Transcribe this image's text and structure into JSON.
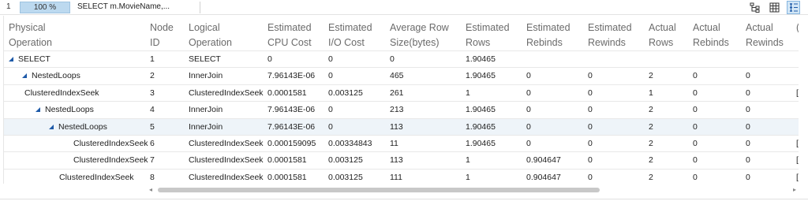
{
  "toolbar": {
    "row_number": "1",
    "zoom": "100 %",
    "query_text": "SELECT m.MovieName,...",
    "buttons": [
      {
        "icon": "tree-view-icon",
        "active": false
      },
      {
        "icon": "grid-view-icon",
        "active": false
      },
      {
        "icon": "list-view-icon",
        "active": true
      }
    ]
  },
  "columns": [
    "Physical\nOperation",
    "Node\nID",
    "Logical\nOperation",
    "Estimated\nCPU Cost",
    "Estimated\nI/O Cost",
    "Average Row\nSize(bytes)",
    "Estimated\nRows",
    "Estimated\nRebinds",
    "Estimated\nRewinds",
    "Actual\nRows",
    "Actual\nRebinds",
    "Actual\nRewinds",
    "("
  ],
  "rows": [
    {
      "level": 0,
      "expandable": true,
      "selected": false,
      "cells": [
        "SELECT",
        "1",
        "SELECT",
        "0",
        "0",
        "0",
        "1.90465",
        "",
        "",
        "",
        "",
        "",
        ""
      ]
    },
    {
      "level": 1,
      "expandable": true,
      "selected": false,
      "cells": [
        "NestedLoops",
        "2",
        "InnerJoin",
        "7.96143E-06",
        "0",
        "465",
        "1.90465",
        "0",
        "0",
        "2",
        "0",
        "0",
        ""
      ]
    },
    {
      "level": 2,
      "expandable": false,
      "selected": false,
      "cells": [
        "ClusteredIndexSeek",
        "3",
        "ClusteredIndexSeek",
        "0.0001581",
        "0.003125",
        "261",
        "1",
        "0",
        "0",
        "1",
        "0",
        "0",
        "["
      ]
    },
    {
      "level": 2,
      "expandable": true,
      "selected": false,
      "cells": [
        "NestedLoops",
        "4",
        "InnerJoin",
        "7.96143E-06",
        "0",
        "213",
        "1.90465",
        "0",
        "0",
        "2",
        "0",
        "0",
        ""
      ]
    },
    {
      "level": 3,
      "expandable": true,
      "selected": true,
      "cells": [
        "NestedLoops",
        "5",
        "InnerJoin",
        "7.96143E-06",
        "0",
        "113",
        "1.90465",
        "0",
        "0",
        "2",
        "0",
        "0",
        ""
      ]
    },
    {
      "level": 4,
      "expandable": false,
      "selected": false,
      "cells": [
        "ClusteredIndexSeek",
        "6",
        "ClusteredIndexSeek",
        "0.000159095",
        "0.00334843",
        "11",
        "1.90465",
        "0",
        "0",
        "2",
        "0",
        "0",
        "["
      ]
    },
    {
      "level": 4,
      "expandable": false,
      "selected": false,
      "cells": [
        "ClusteredIndexSeek",
        "7",
        "ClusteredIndexSeek",
        "0.0001581",
        "0.003125",
        "113",
        "1",
        "0.904647",
        "0",
        "2",
        "0",
        "0",
        "["
      ]
    },
    {
      "level": 3,
      "expandable": false,
      "selected": false,
      "cells": [
        "ClusteredIndexSeek",
        "8",
        "ClusteredIndexSeek",
        "0.0001581",
        "0.003125",
        "111",
        "1",
        "0.904647",
        "0",
        "2",
        "0",
        "0",
        "["
      ]
    }
  ],
  "colors": {
    "accent": "#1e5aa8",
    "selected_row": "#eef4f9",
    "header_text": "#6b6b6b"
  }
}
